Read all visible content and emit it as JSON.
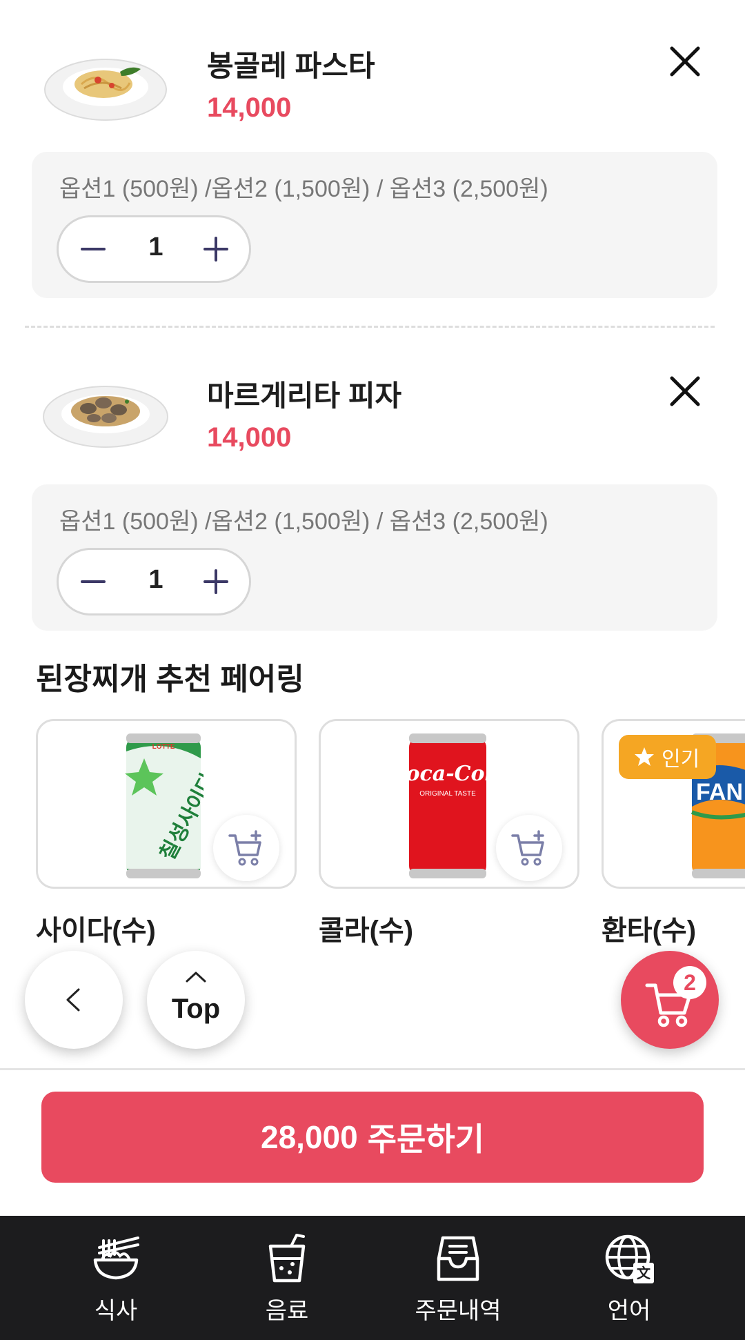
{
  "cart": {
    "items": [
      {
        "name": "봉골레 파스타",
        "price": "14,000",
        "options": "옵션1 (500원) /옵션2 (1,500원) / 옵션3 (2,500원)",
        "quantity": "1",
        "image_icon": "pasta-plate-image"
      },
      {
        "name": "마르게리타 피자",
        "price": "14,000",
        "options": "옵션1 (500원) /옵션2 (1,500원) / 옵션3 (2,500원)",
        "quantity": "1",
        "image_icon": "clam-pasta-plate-image"
      }
    ]
  },
  "pairing": {
    "title": "된장찌개 추천 페어링",
    "items": [
      {
        "name": "사이다(수)",
        "image_icon": "cider-can-image",
        "can_text": "칠성사이다",
        "brand": "LOTTE"
      },
      {
        "name": "콜라(수)",
        "image_icon": "cola-can-image",
        "can_text": "Coca-Cola",
        "sub_text": "ORIGINAL TASTE"
      },
      {
        "name": "환타(수)",
        "image_icon": "fanta-can-image",
        "badge": "인기",
        "can_text": "FAN"
      }
    ]
  },
  "floating": {
    "back_icon": "chevron-left-icon",
    "top_label": "Top",
    "cart_count": "2"
  },
  "order": {
    "total": "28,000",
    "label": "주문하기"
  },
  "tabbar": {
    "tabs": [
      {
        "label": "식사",
        "icon": "noodle-bowl-icon"
      },
      {
        "label": "음료",
        "icon": "drink-cup-icon"
      },
      {
        "label": "주문내역",
        "icon": "order-history-icon"
      },
      {
        "label": "언어",
        "icon": "globe-language-icon"
      }
    ]
  },
  "colors": {
    "accent": "#e84a5f",
    "badge": "#f5a623",
    "tabbar_bg": "#1c1c1e",
    "option_bg": "#f5f5f5",
    "stepper_icon": "#3b3866"
  }
}
